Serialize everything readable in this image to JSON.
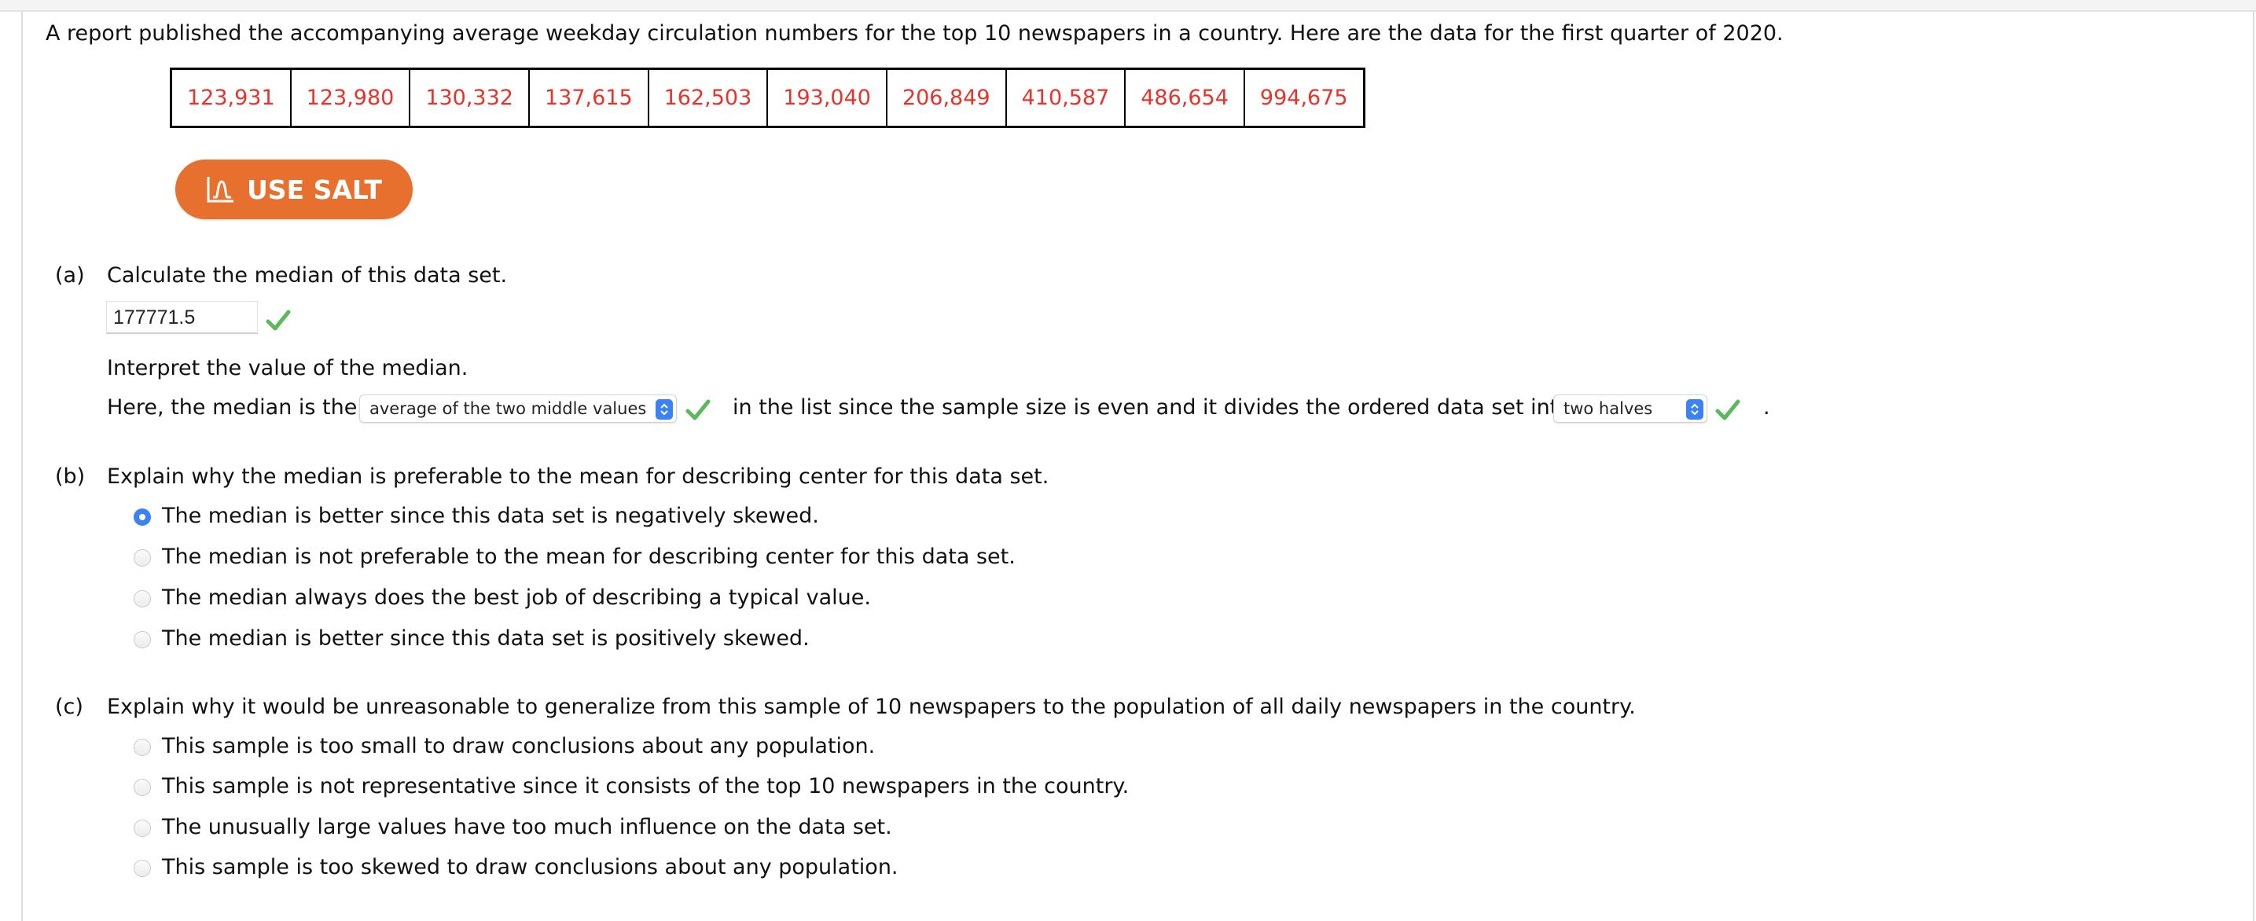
{
  "intro": "A report published the accompanying average weekday circulation numbers for the top 10 newspapers in a country. Here are the data for the first quarter of 2020.",
  "data_values": [
    "123,931",
    "123,980",
    "130,332",
    "137,615",
    "162,503",
    "193,040",
    "206,849",
    "410,587",
    "486,654",
    "994,675"
  ],
  "salt_button": {
    "label": "USE SALT",
    "icon": "salt-graph-icon"
  },
  "colors": {
    "data_text": "#e8322a",
    "salt_button": "#e8702f",
    "select_accent": "#3b82f6",
    "check": "#5cb85c"
  },
  "part_a": {
    "label": "(a)",
    "question": "Calculate the median of this data set.",
    "answer_value": "177771.5",
    "answer_status": "correct",
    "interpret_prompt": "Interpret the value of the median.",
    "sentence_before": "Here, the median is the",
    "select1_value": "average of the two middle values",
    "sentence_middle": "in the list since the sample size is even and it divides the ordered data set into",
    "select2_value": "two halves",
    "sentence_end": "."
  },
  "part_b": {
    "label": "(b)",
    "question": "Explain why the median is preferable to the mean for describing center for this data set.",
    "options": [
      {
        "text": "The median is better since this data set is negatively skewed.",
        "selected": true
      },
      {
        "text": "The median is not preferable to the mean for describing center for this data set.",
        "selected": false
      },
      {
        "text": "The median always does the best job of describing a typical value.",
        "selected": false
      },
      {
        "text": "The median is better since this data set is positively skewed.",
        "selected": false
      }
    ]
  },
  "part_c": {
    "label": "(c)",
    "question": "Explain why it would be unreasonable to generalize from this sample of 10 newspapers to the population of all daily newspapers in the country.",
    "options": [
      {
        "text": "This sample is too small to draw conclusions about any population.",
        "selected": false
      },
      {
        "text": "This sample is not representative since it consists of the top 10 newspapers in the country.",
        "selected": false
      },
      {
        "text": "The unusually large values have too much influence on the data set.",
        "selected": false
      },
      {
        "text": "This sample is too skewed to draw conclusions about any population.",
        "selected": false
      }
    ]
  }
}
